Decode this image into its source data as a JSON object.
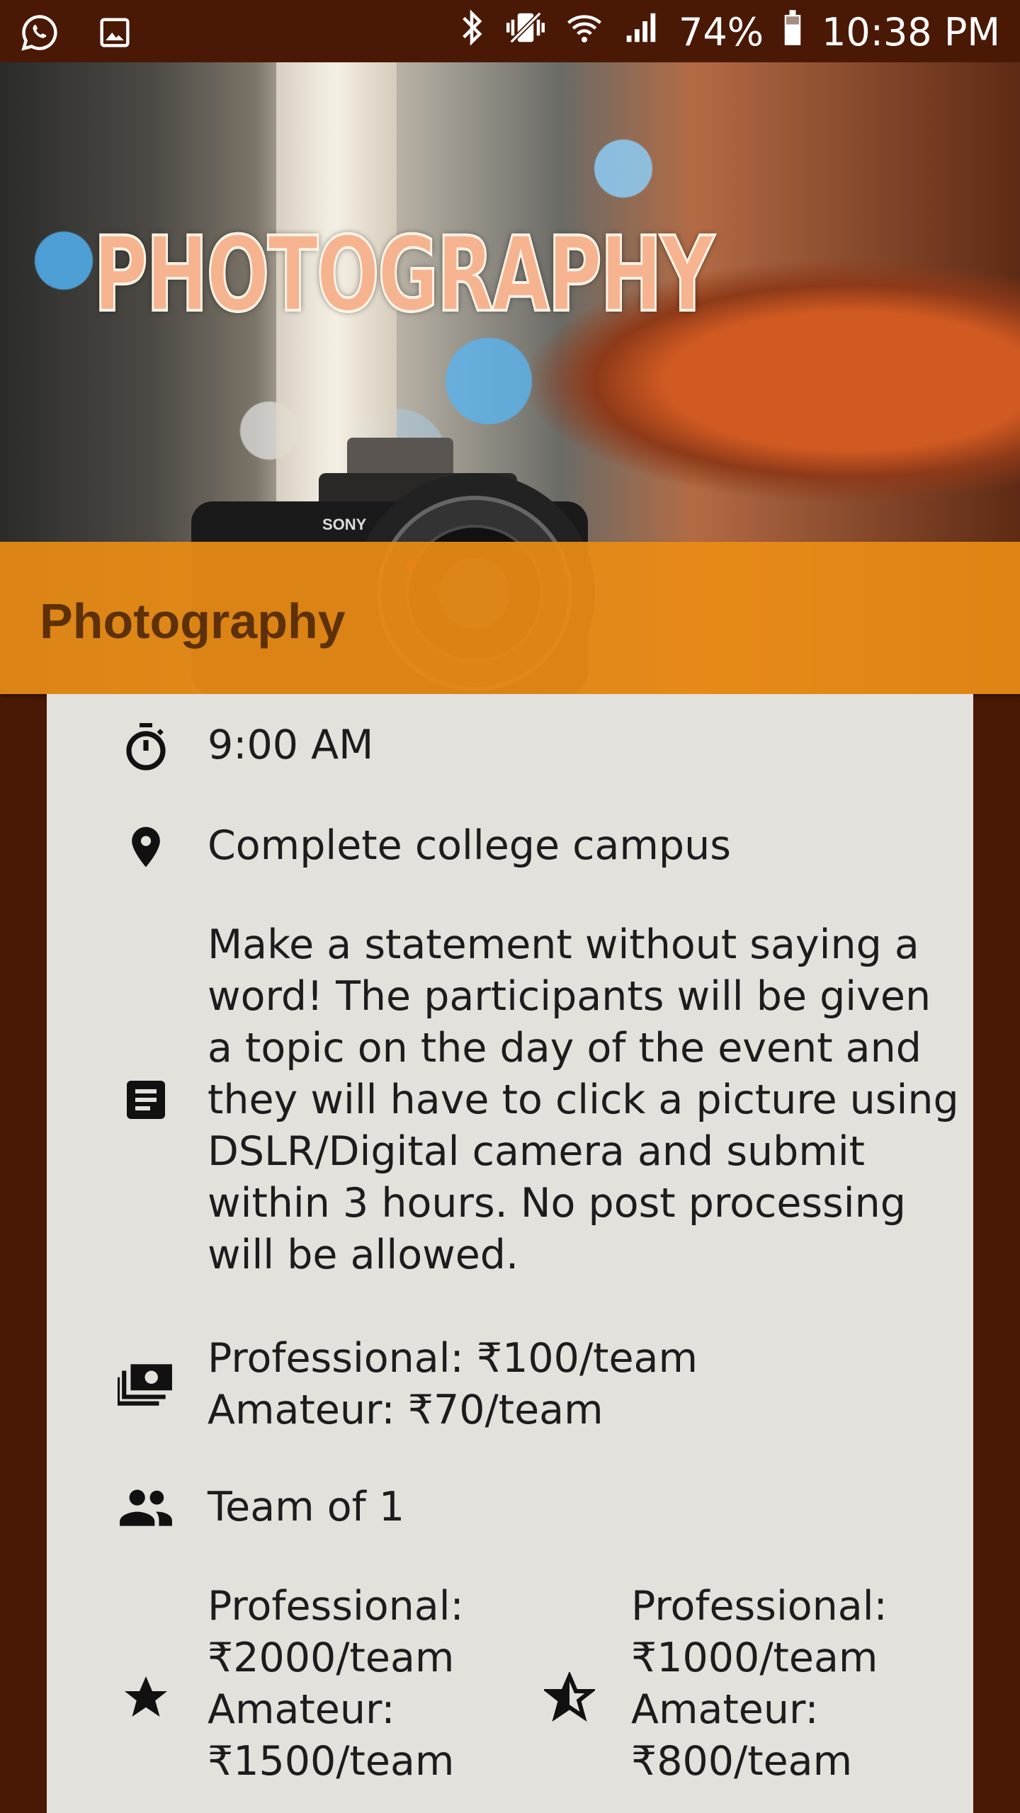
{
  "status_bar": {
    "left_icons": [
      "whatsapp-icon",
      "image-icon"
    ],
    "right_icons": [
      "bluetooth-icon",
      "vibrate-icon",
      "wifi-icon",
      "signal-icon"
    ],
    "battery_percent": "74%",
    "time": "10:38 PM"
  },
  "hero": {
    "banner_text": "PHOTOGRAPHY",
    "camera_brand": "SONY"
  },
  "event": {
    "title": "Photography",
    "time": "9:00 AM",
    "location": "Complete college campus",
    "description_lines": [
      "Make a statement without saying a",
      "word! The participants will be given",
      "a topic on the day of the event and",
      "they will have to click a picture using",
      "DSLR/Digital camera and submit",
      "within 3 hours. No post processing",
      "will be allowed."
    ],
    "fees": {
      "professional": "Professional: ₹100/team",
      "amateur": "Amateur: ₹70/team"
    },
    "team": "Team of 1",
    "first_prize": {
      "line1": "Professional:",
      "line2": "₹2000/team",
      "line3": "Amateur:",
      "line4": "₹1500/team"
    },
    "second_prize": {
      "line1": "Professional:",
      "line2": "₹1000/team",
      "line3": "Amateur:",
      "line4": "₹800/team"
    }
  },
  "colors": {
    "background": "#4a1905",
    "title_bar": "#e98c14",
    "title_text": "#5d3006",
    "card": "#e2e1dc"
  }
}
